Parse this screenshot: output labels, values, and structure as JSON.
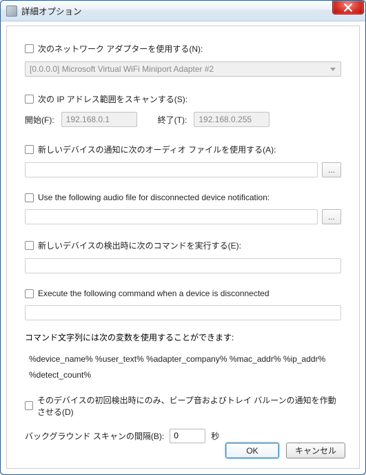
{
  "window": {
    "title": "詳細オプション"
  },
  "adapter": {
    "checkbox_label": "次のネットワーク アダプターを使用する(N):",
    "value": "[0.0.0.0]  Microsoft Virtual WiFi Miniport Adapter #2"
  },
  "iprange": {
    "checkbox_label": "次の IP アドレス範囲をスキャンする(S):",
    "from_label": "開始(F):",
    "from_value": "192.168.0.1",
    "to_label": "終了(T):",
    "to_value": "192.168.0.255"
  },
  "audio_new": {
    "checkbox_label": "新しいデバイスの通知に次のオーディオ ファイルを使用する(A):",
    "value": "",
    "browse": "..."
  },
  "audio_disc": {
    "checkbox_label": "Use the following audio file for disconnected device notification:",
    "value": "",
    "browse": "..."
  },
  "cmd_new": {
    "checkbox_label": "新しいデバイスの検出時に次のコマンドを実行する(E):",
    "value": ""
  },
  "cmd_disc": {
    "checkbox_label": "Execute the following command when a device is disconnected",
    "value": ""
  },
  "vars": {
    "intro": "コマンド文字列には次の変数を使用することができます:",
    "line1": "%device_name%  %user_text%  %adapter_company%  %mac_addr%  %ip_addr%",
    "line2": "%detect_count%"
  },
  "first_detect": {
    "checkbox_label": "そのデバイスの初回検出時にのみ、ビープ音およびトレイ バルーンの通知を作動させる(D)"
  },
  "bgscan": {
    "label": "バックグラウンド スキャンの間隔(B):",
    "value": "0",
    "unit": "秒"
  },
  "buttons": {
    "ok": "OK",
    "cancel": "キャンセル"
  }
}
